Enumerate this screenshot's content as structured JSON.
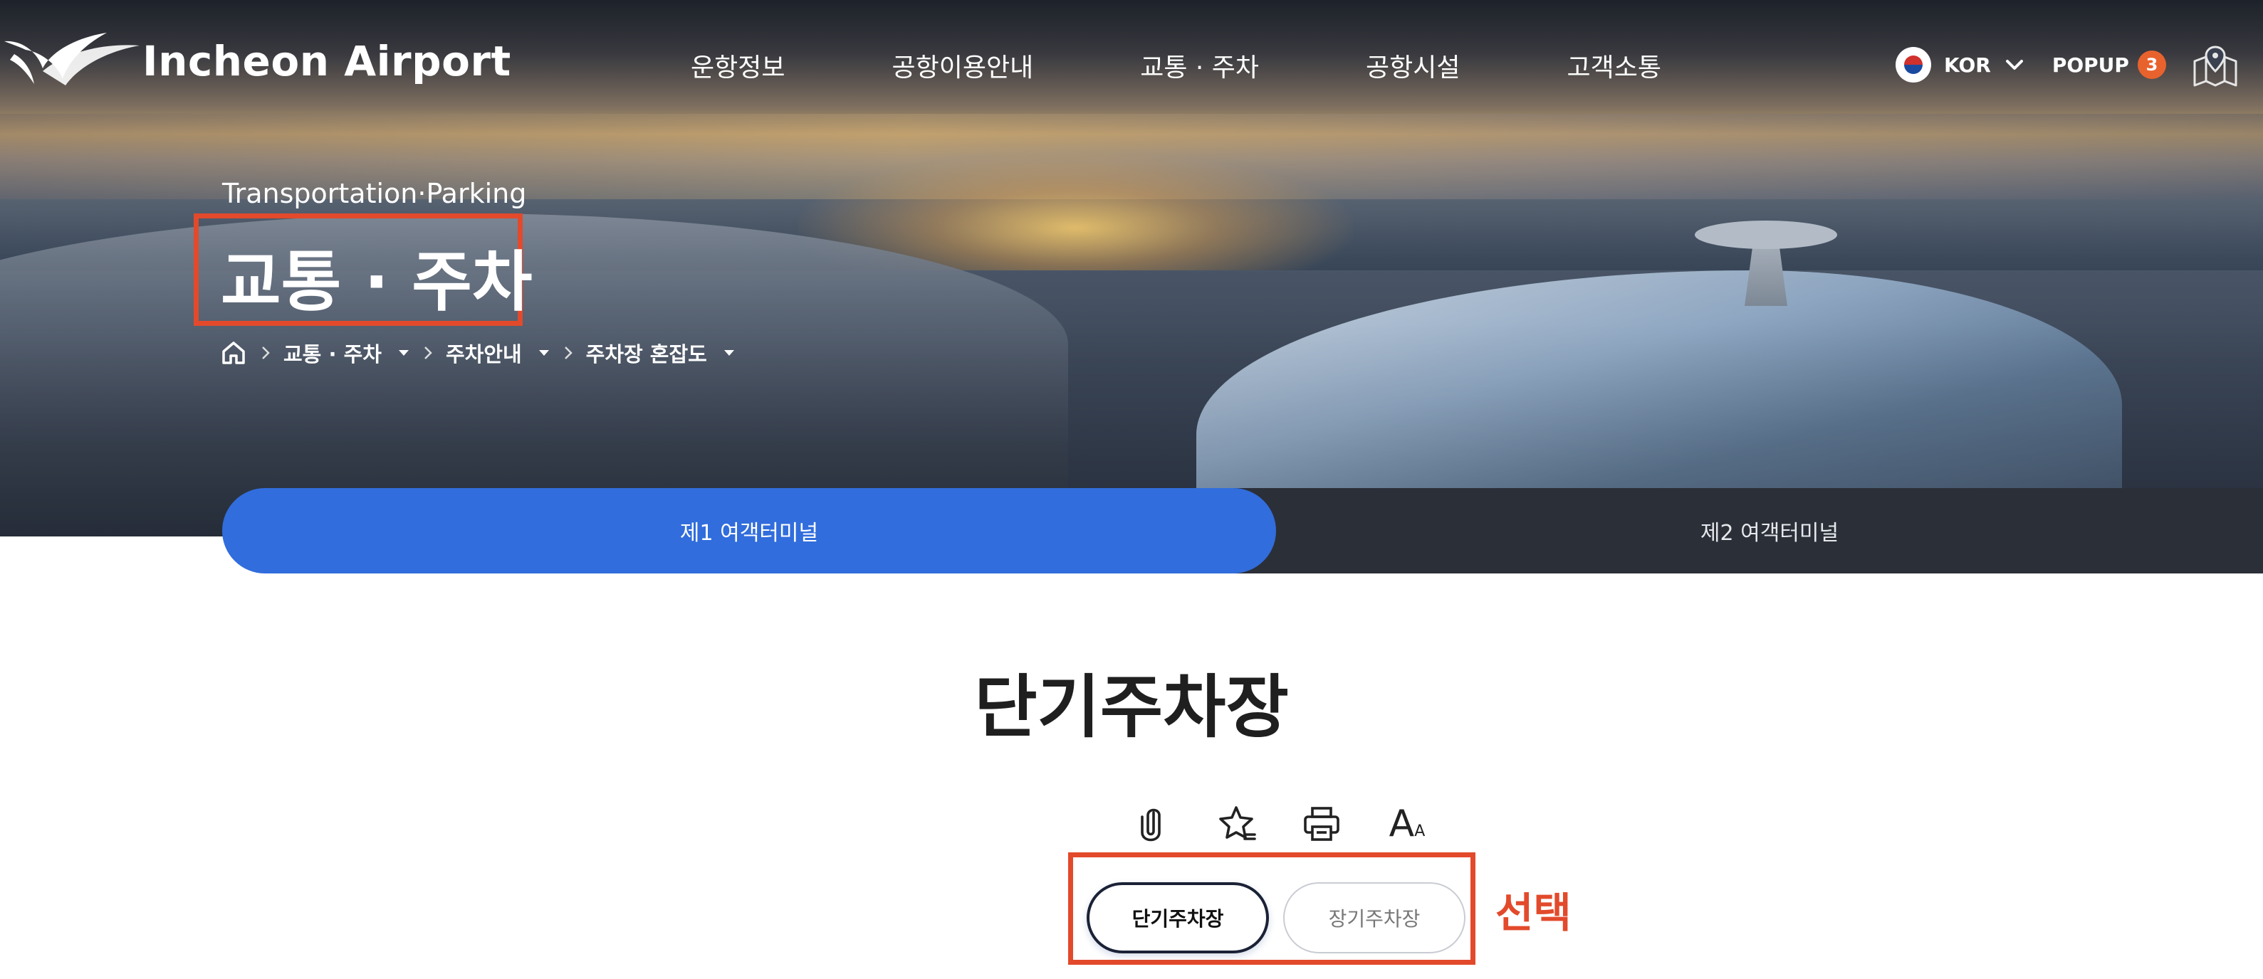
{
  "header": {
    "logo_text": "Incheon Airport",
    "nav": [
      "운항정보",
      "공항이용안내",
      "교통 · 주차",
      "공항시설",
      "고객소통"
    ],
    "language": "KOR",
    "popup_label": "POPUP",
    "popup_count": "3"
  },
  "hero": {
    "subtitle_en": "Transportation·Parking",
    "title": "교통 · 주차",
    "breadcrumb": [
      "교통 · 주차",
      "주차안내",
      "주차장 혼잡도"
    ]
  },
  "terminal_tabs": {
    "t1": "제1 여객터미널",
    "t2": "제2 여객터미널",
    "active": "t1"
  },
  "content": {
    "title": "단기주차장",
    "tools": [
      "clip-icon",
      "star-icon",
      "print-icon",
      "font-size-icon"
    ],
    "font_size_glyph_large": "A",
    "font_size_glyph_small": "A",
    "segment": {
      "short": "단기주차장",
      "long": "장기주차장",
      "selected": "short"
    },
    "annotation": "선택"
  },
  "colors": {
    "accent_blue": "#316ddc",
    "annotation_red": "#e24a2b",
    "popup_badge": "#e8622e",
    "dark_tab": "#2b2f38"
  }
}
